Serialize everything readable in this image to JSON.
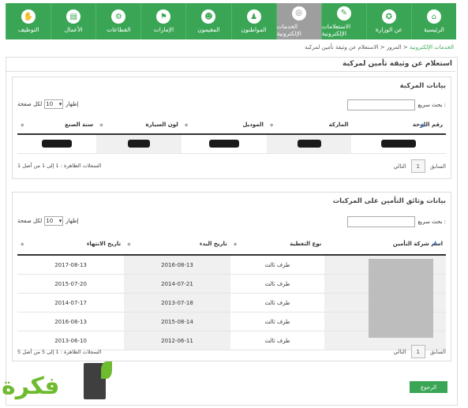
{
  "nav": {
    "items": [
      {
        "label": "الرئيسية",
        "icon": "home-icon",
        "glyph": "⌂"
      },
      {
        "label": "عن الوزارة",
        "icon": "ministry-icon",
        "glyph": "✪"
      },
      {
        "label": "الاستعلامات الإلكترونية",
        "icon": "inquiry-icon",
        "glyph": "✎"
      },
      {
        "label": "الخدمات الإلكترونية",
        "icon": "globe-icon",
        "glyph": "◎",
        "active": true
      },
      {
        "label": "المواطنون",
        "icon": "citizen-icon",
        "glyph": "♟"
      },
      {
        "label": "المقيمون",
        "icon": "residents-icon",
        "glyph": "☻"
      },
      {
        "label": "الإمارات",
        "icon": "emirates-icon",
        "glyph": "⚑"
      },
      {
        "label": "القطاعات",
        "icon": "sectors-icon",
        "glyph": "⚙"
      },
      {
        "label": "الأعمال",
        "icon": "business-icon",
        "glyph": "▤"
      },
      {
        "label": "التوظيف",
        "icon": "employment-icon",
        "glyph": "✋"
      }
    ]
  },
  "breadcrumb": {
    "root": "الخدمات الإلكترونية",
    "sep1": "<",
    "mid": "المرور",
    "sep2": "<",
    "current": "الاستعلام عن وثيقة تأمين لمركبة"
  },
  "page_title": "استعلام عن وثيقة تأمين لمركبة",
  "vehicle_panel": {
    "title": "بيانات المركبة",
    "search_label": "بحث سريع :",
    "show_label": "إظهار",
    "page_size": "10",
    "per_page_label": "لكل صفحة",
    "columns": [
      "رقم اللوحة",
      "الماركة",
      "الموديل",
      "لون السيارة",
      "سنة الصنع"
    ],
    "info": "السجلات الظاهرة : 1 إلى 1 من أصل 1",
    "prev": "السابق",
    "page": "1",
    "next": "التالي"
  },
  "insurance_panel": {
    "title": "بيانات وثائق التأمين على المركبات",
    "search_label": "بحث سريع :",
    "show_label": "إظهار",
    "page_size": "10",
    "per_page_label": "لكل صفحة",
    "columns": [
      "اسم شركة التأمين",
      "نوع التغطية",
      "تاريخ البدء",
      "تاريخ الانتهاء"
    ],
    "rows": [
      {
        "coverage": "طرف ثالث",
        "start": "2016-08-13",
        "end": "2017-08-13"
      },
      {
        "coverage": "طرف ثالث",
        "start": "2014-07-21",
        "end": "2015-07-20"
      },
      {
        "coverage": "طرف ثالث",
        "start": "2013-07-18",
        "end": "2014-07-17"
      },
      {
        "coverage": "طرف ثالث",
        "start": "2015-08-14",
        "end": "2016-08-13"
      },
      {
        "coverage": "طرف ثالث",
        "start": "2012-06-11",
        "end": "2013-06-10"
      }
    ],
    "info": "السجلات الظاهرة : 1 إلى 5 من أصل 5",
    "prev": "السابق",
    "page": "1",
    "next": "التالي"
  },
  "return_button": "الرجوع",
  "watermark": "فكرة"
}
